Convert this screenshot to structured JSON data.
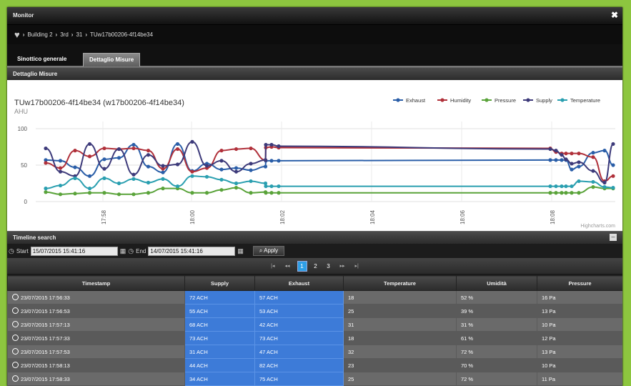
{
  "window": {
    "title": "Monitor",
    "close_label": "✖"
  },
  "breadcrumb": [
    "Building 2",
    "3rd",
    "31",
    "TUw17b00206-4f14be34"
  ],
  "tabs": [
    {
      "label": "Sinottico generale"
    },
    {
      "label": "Dettaglio Misure"
    }
  ],
  "section_title": "Dettaglio Misure",
  "chart_data": {
    "type": "line",
    "title": "TUw17b00206-4f14be34 (w17b00206-4f14be34)",
    "subtitle": "AHU",
    "credit": "Highcharts.com",
    "ylim": [
      0,
      100
    ],
    "yticks": [
      "100",
      "50",
      "0"
    ],
    "xticks": [
      "17:58",
      "18:00",
      "18:02",
      "18:04",
      "18:06",
      "18:08"
    ],
    "legend_position": "top-right",
    "series": [
      {
        "name": "Exhaust",
        "color": "#2a5ea8",
        "values": [
          57,
          56,
          47,
          35,
          58,
          60,
          78,
          48,
          40,
          79,
          42,
          52,
          44,
          46,
          43,
          48,
          56,
          56,
          56,
          57,
          57,
          57,
          57,
          44,
          48,
          67,
          70,
          50
        ]
      },
      {
        "name": "Humidity",
        "color": "#b0303a",
        "values": [
          53,
          46,
          70,
          62,
          73,
          72,
          73,
          70,
          45,
          72,
          41,
          46,
          70,
          72,
          73,
          57,
          74,
          75,
          74,
          73,
          68,
          66,
          66,
          66,
          66,
          61,
          28,
          35
        ]
      },
      {
        "name": "Pressure",
        "color": "#5aa33a",
        "values": [
          13,
          10,
          11,
          12,
          12,
          10,
          10,
          12,
          18,
          18,
          12,
          12,
          16,
          19,
          12,
          13,
          12,
          12,
          12,
          12,
          12,
          12,
          12,
          12,
          12,
          20,
          18,
          18
        ]
      },
      {
        "name": "Supply",
        "color": "#3d3a7a",
        "values": [
          73,
          41,
          35,
          79,
          45,
          72,
          37,
          64,
          49,
          51,
          82,
          49,
          56,
          41,
          52,
          57,
          78,
          78,
          76,
          72,
          70,
          64,
          58,
          52,
          54,
          42,
          26,
          79
        ]
      },
      {
        "name": "Temperature",
        "color": "#2a9fb0",
        "values": [
          18,
          22,
          32,
          18,
          32,
          25,
          31,
          26,
          31,
          21,
          35,
          34,
          30,
          25,
          28,
          25,
          21,
          21,
          21,
          21,
          21,
          21,
          21,
          21,
          28,
          27,
          20,
          19
        ]
      }
    ]
  },
  "timeline": {
    "title": "Timeline search",
    "start_label": "Start",
    "start_value": "15/07/2015 15:41:16",
    "end_label": "End",
    "end_value": "14/07/2015 15:41:16",
    "apply_label": "Apply",
    "minimize": "–"
  },
  "pager": {
    "first": "|◂",
    "prev": "◂◂",
    "pages": [
      "1",
      "2",
      "3"
    ],
    "next": "▸▸",
    "last": "▸|"
  },
  "table": {
    "columns": [
      "Timestamp",
      "Supply",
      "Exhaust",
      "Temperature",
      "Umidità",
      "Pressure"
    ],
    "rows": [
      [
        "23/07/2015 17:56:33",
        "72 ACH",
        "57 ACH",
        "18",
        "52 %",
        "16 Pa"
      ],
      [
        "23/07/2015 17:56:53",
        "55 ACH",
        "53 ACH",
        "25",
        "39 %",
        "13 Pa"
      ],
      [
        "23/07/2015 17:57:13",
        "68 ACH",
        "42 ACH",
        "31",
        "31 %",
        "10 Pa"
      ],
      [
        "23/07/2015 17:57:33",
        "73 ACH",
        "73 ACH",
        "18",
        "61 %",
        "12 Pa"
      ],
      [
        "23/07/2015 17:57:53",
        "31 ACH",
        "47 ACH",
        "32",
        "72 %",
        "13 Pa"
      ],
      [
        "23/07/2015 17:58:13",
        "44 ACH",
        "82 ACH",
        "23",
        "70 %",
        "10 Pa"
      ],
      [
        "23/07/2015 17:58:33",
        "34 ACH",
        "75 ACH",
        "25",
        "72 %",
        "11 Pa"
      ]
    ]
  }
}
